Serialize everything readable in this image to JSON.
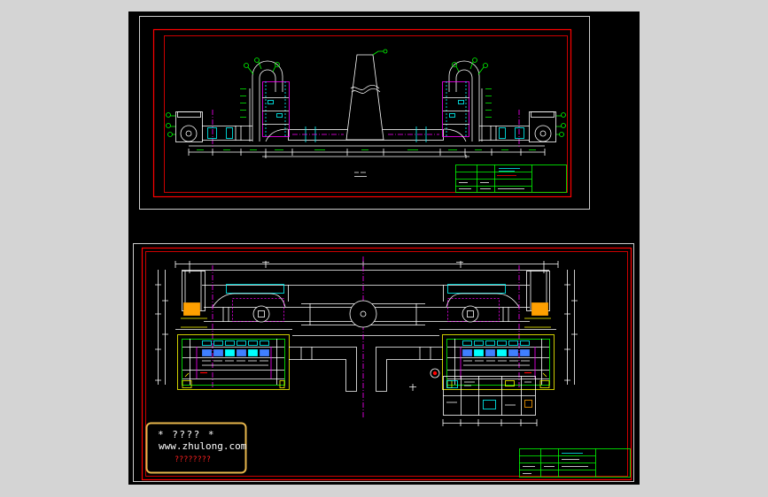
{
  "watermark": {
    "line1": "* ???? *",
    "line2": "www.zhulong.com",
    "line3": "????????"
  },
  "colors": {
    "page-bg": "#d4d4d4",
    "canvas": "#000000",
    "white": "#ffffff",
    "red": "#ff0000",
    "green": "#00ff00",
    "cyan": "#00ffff",
    "magenta": "#ff00ff",
    "yellow": "#ffff00",
    "blue": "#3f7fff",
    "orange": "#ff9f00",
    "wm-border": "#e7b64c",
    "wm-red": "#ff2020"
  }
}
